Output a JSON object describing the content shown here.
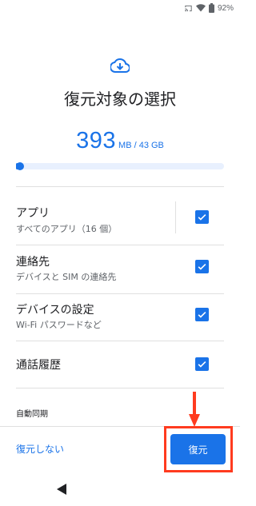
{
  "status_bar": {
    "battery_text": "92%",
    "icons": [
      "cast-icon",
      "wifi-icon",
      "battery-icon"
    ]
  },
  "header": {
    "icon": "cloud-download-icon",
    "title": "復元対象の選択"
  },
  "size": {
    "amount": "393",
    "unit_total": " MB / 43 GB",
    "progress_fraction": 0.01
  },
  "items": [
    {
      "title": "アプリ",
      "subtitle": "すべてのアプリ（16 個）",
      "checked": true
    },
    {
      "title": "連絡先",
      "subtitle": "デバイスと SIM の連絡先",
      "checked": true
    },
    {
      "title": "デバイスの設定",
      "subtitle": "Wi-Fi パスワードなど",
      "checked": true
    },
    {
      "title": "通話履歴",
      "subtitle": "",
      "checked": true
    }
  ],
  "section_header": "自動同期",
  "actions": {
    "skip_label": "復元しない",
    "restore_label": "復元"
  },
  "colors": {
    "accent": "#1a73e8",
    "highlight": "#ff3b1f",
    "progress_track": "#e8f0fe"
  }
}
